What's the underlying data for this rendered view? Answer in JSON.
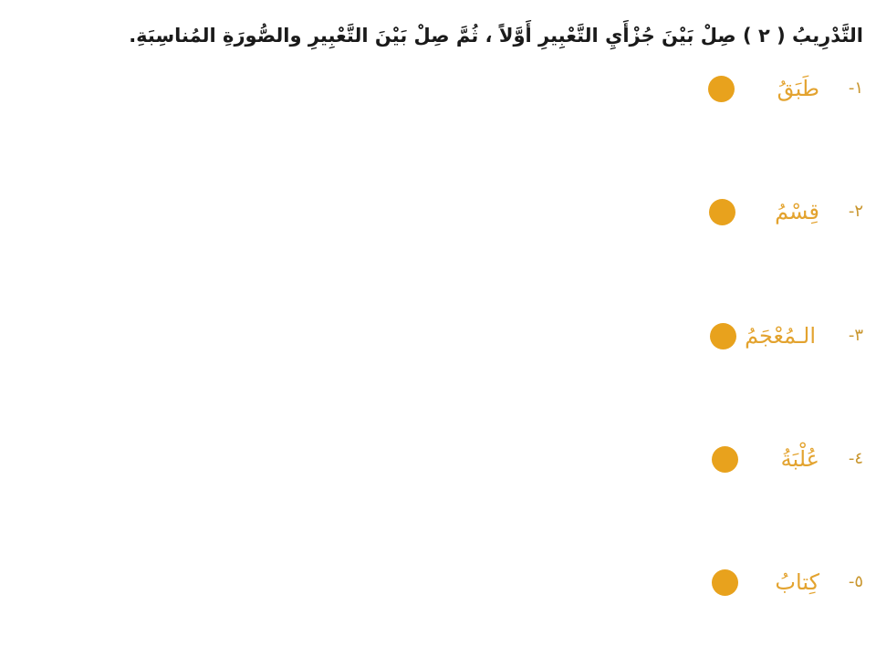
{
  "instruction": "التَّدْرِيبُ ( ٢ ) صِلْ بَيْنَ جُزْأَيِ التَّعْبِيرِ أَوَّلاً ، ثُمَّ صِلْ بَيْنَ التَّعْبِيرِ والصُّورَةِ المُناسِبَةِ.",
  "items": [
    {
      "number": "١-",
      "word": "طَبَقُ"
    },
    {
      "number": "٢-",
      "word": "قِسْمُ"
    },
    {
      "number": "٣-",
      "word": "الـمُعْجَمُ"
    },
    {
      "number": "٤-",
      "word": "عُلْبَةُ"
    },
    {
      "number": "٥-",
      "word": "كِتابُ"
    }
  ],
  "colors": {
    "word": "#e3a32f",
    "number": "#c9962e",
    "dot": "#e8a21d",
    "instruction": "#1a1a1a"
  }
}
